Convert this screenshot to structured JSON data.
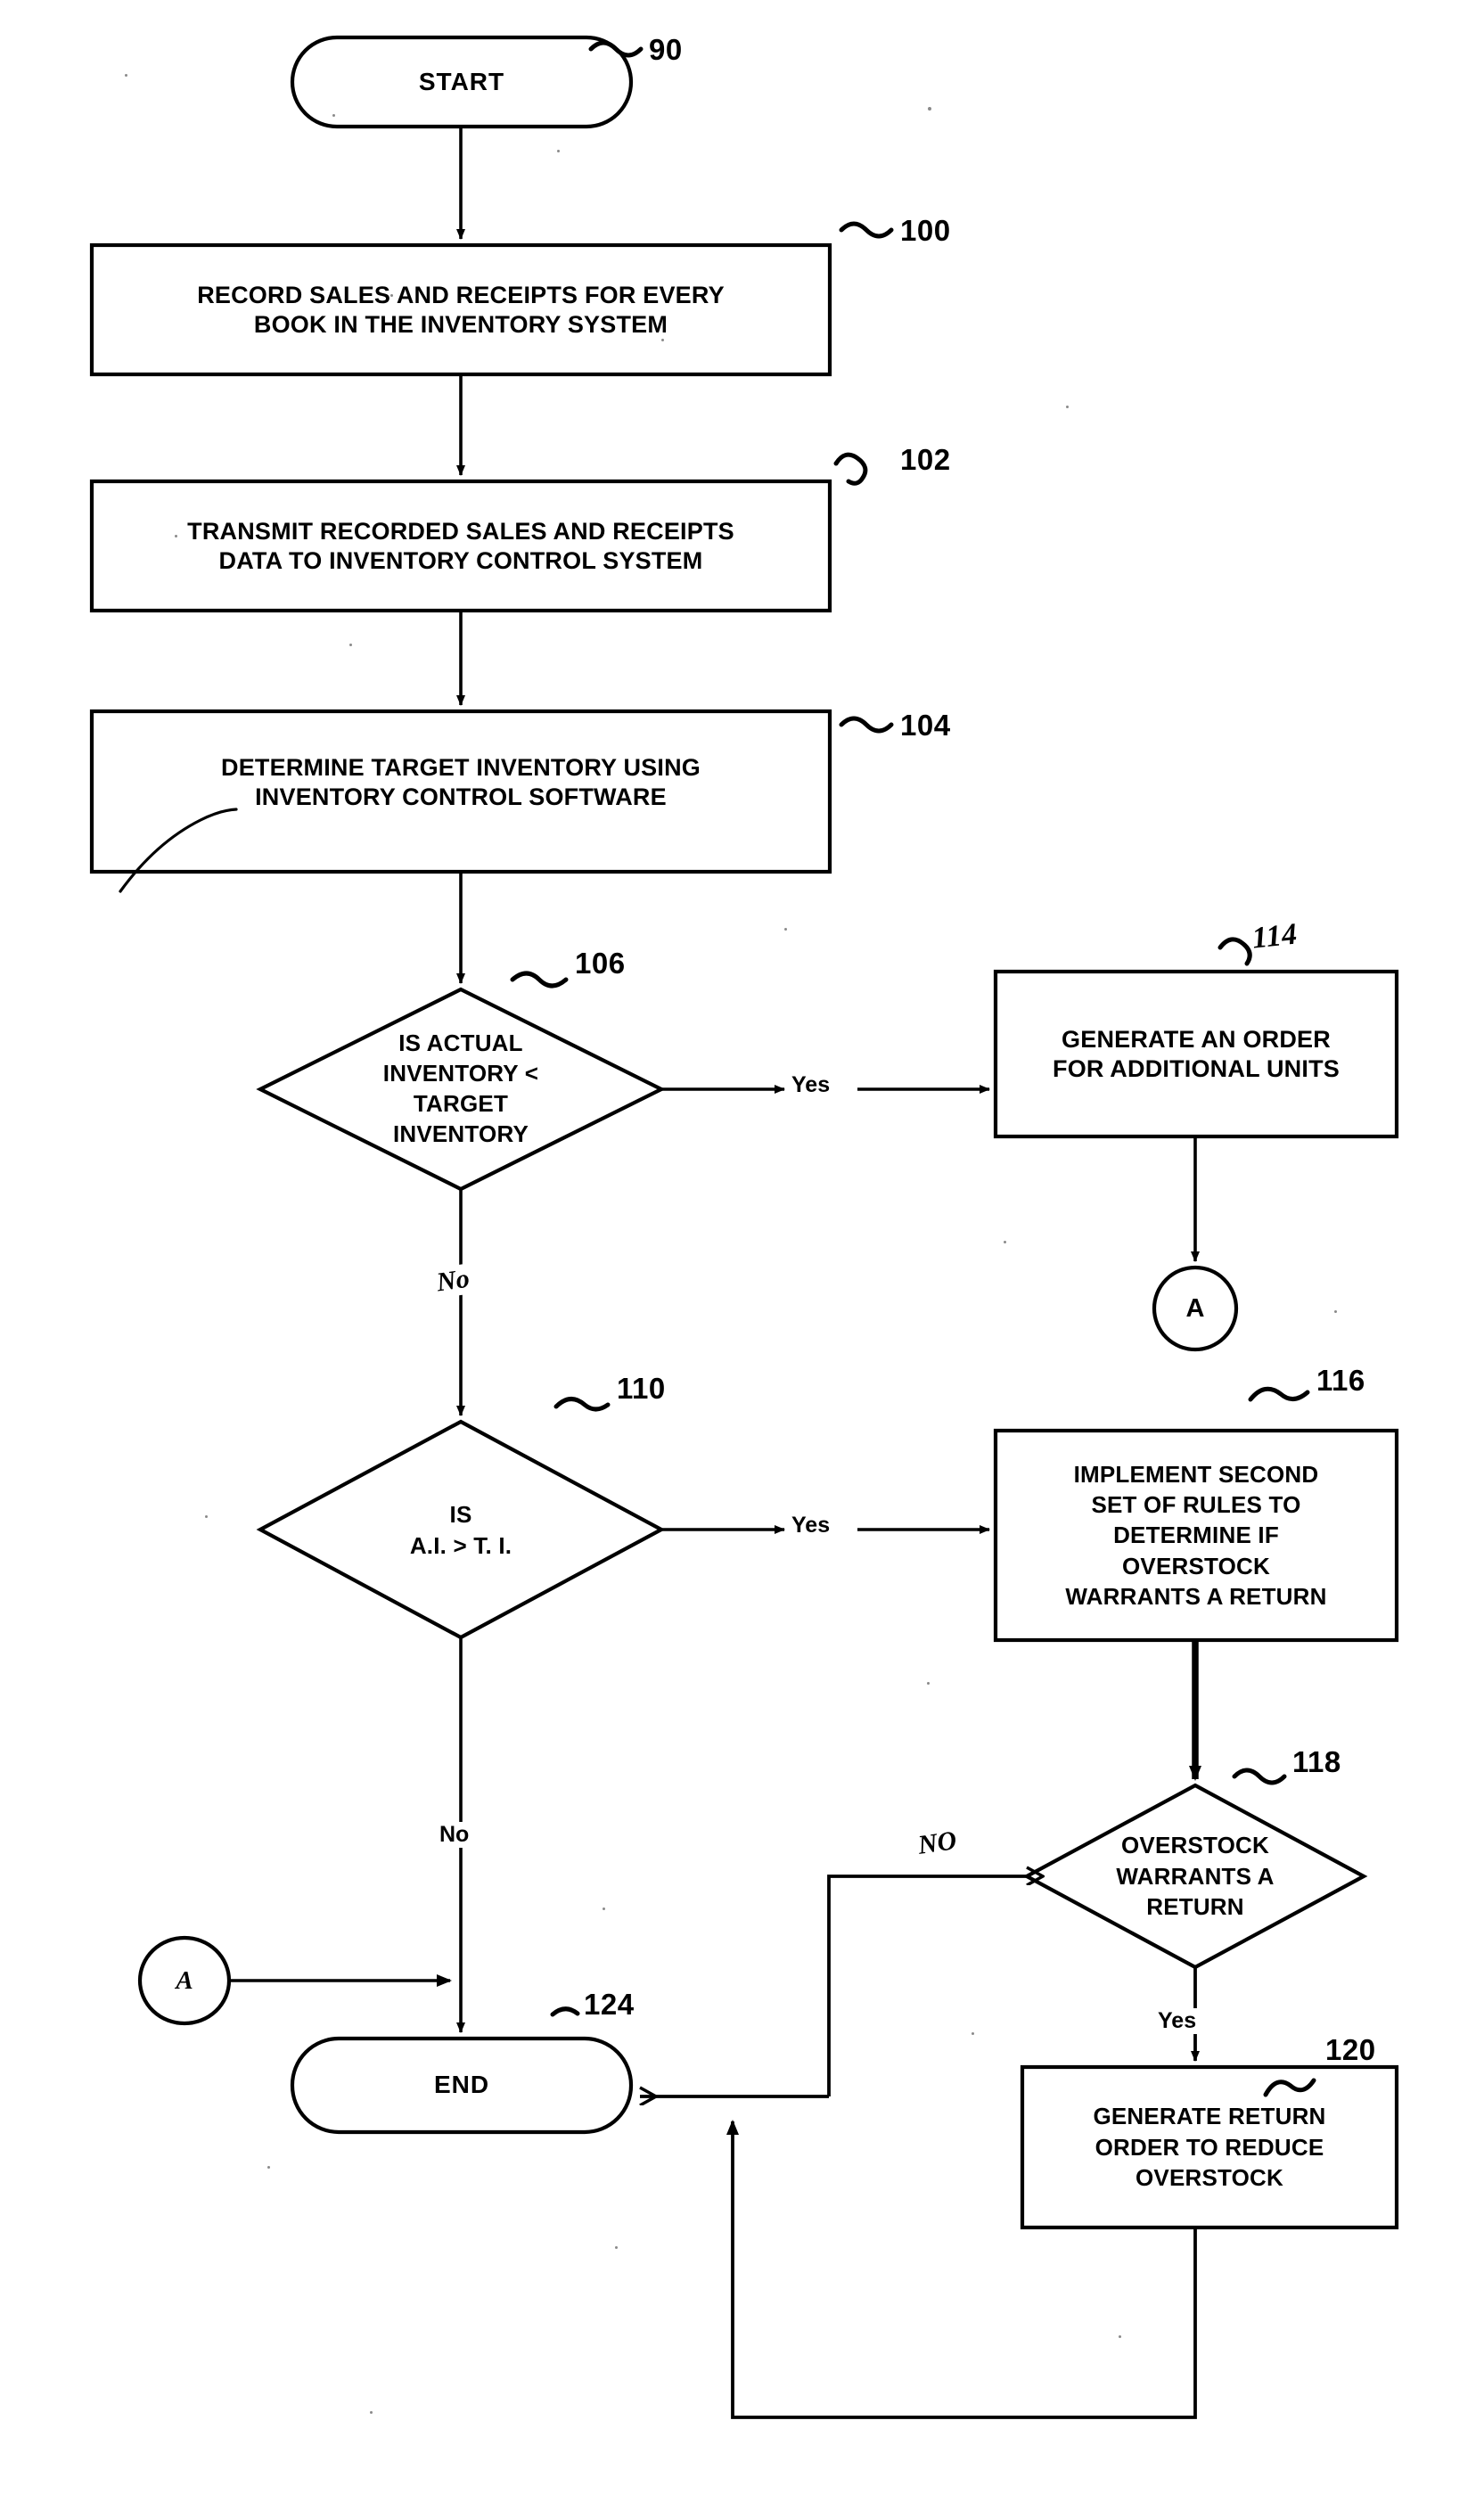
{
  "figure": {
    "type": "patent-flowchart",
    "title": "Inventory control process flowchart"
  },
  "nodes": {
    "start": {
      "label": "START",
      "ref": "90",
      "shape": "terminal"
    },
    "record": {
      "label": "RECORD SALES AND RECEIPTS FOR EVERY\nBOOK IN THE INVENTORY SYSTEM",
      "ref": "100",
      "shape": "process"
    },
    "transmit": {
      "label": "TRANSMIT RECORDED SALES AND RECEIPTS\nDATA TO INVENTORY CONTROL SYSTEM",
      "ref": "102",
      "shape": "process"
    },
    "determine": {
      "label": "DETERMINE TARGET INVENTORY USING\nINVENTORY CONTROL SOFTWARE",
      "ref": "104",
      "shape": "process"
    },
    "decision_actual": {
      "label": "IS ACTUAL\nINVENTORY <\nTARGET\nINVENTORY",
      "ref": "106",
      "shape": "decision"
    },
    "generate_order": {
      "label": "GENERATE AN ORDER\nFOR ADDITIONAL UNITS",
      "ref": "114",
      "shape": "process"
    },
    "connector_a_top": {
      "label": "A",
      "shape": "connector"
    },
    "decision_ai_ti": {
      "label": "IS\nA.I. > T. I.",
      "ref": "110",
      "shape": "decision"
    },
    "implement_rules": {
      "label": "IMPLEMENT SECOND\nSET OF RULES TO\nDETERMINE IF\nOVERSTOCK\nWARRANTS A RETURN",
      "ref": "116",
      "shape": "process"
    },
    "decision_overstock": {
      "label": "OVERSTOCK\nWARRANTS A\nRETURN",
      "ref": "118",
      "shape": "decision"
    },
    "generate_return": {
      "label": "GENERATE RETURN\nORDER TO REDUCE\nOVERSTOCK",
      "ref": "120",
      "shape": "process"
    },
    "connector_a_bottom": {
      "label": "A",
      "shape": "connector"
    },
    "end": {
      "label": "END",
      "ref": "124",
      "shape": "terminal"
    }
  },
  "edge_labels": {
    "actual_yes": "Yes",
    "actual_no": "No",
    "ai_ti_yes": "Yes",
    "ai_ti_no": "No",
    "overstock_no": "NO",
    "overstock_yes": "Yes"
  },
  "refs": {
    "start": "~ 90",
    "record": "~ 100",
    "transmit": "~ 102",
    "determine": "~ 104",
    "decision_actual": "~ 106",
    "generate_order": "~ 114",
    "implement_rules": "~ 116",
    "decision_ai_ti": "~ 110",
    "decision_overstock": "~ 118",
    "generate_return": "~ 120",
    "end": "~ 124"
  },
  "ref_numbers": {
    "start": "90",
    "record": "100",
    "transmit": "102",
    "determine": "104",
    "decision_actual": "106",
    "generate_order": "114",
    "implement_rules": "116",
    "decision_ai_ti": "110",
    "decision_overstock": "118",
    "generate_return": "120",
    "end": "124"
  },
  "colors": {
    "stroke": "#000000",
    "background": "#ffffff"
  }
}
